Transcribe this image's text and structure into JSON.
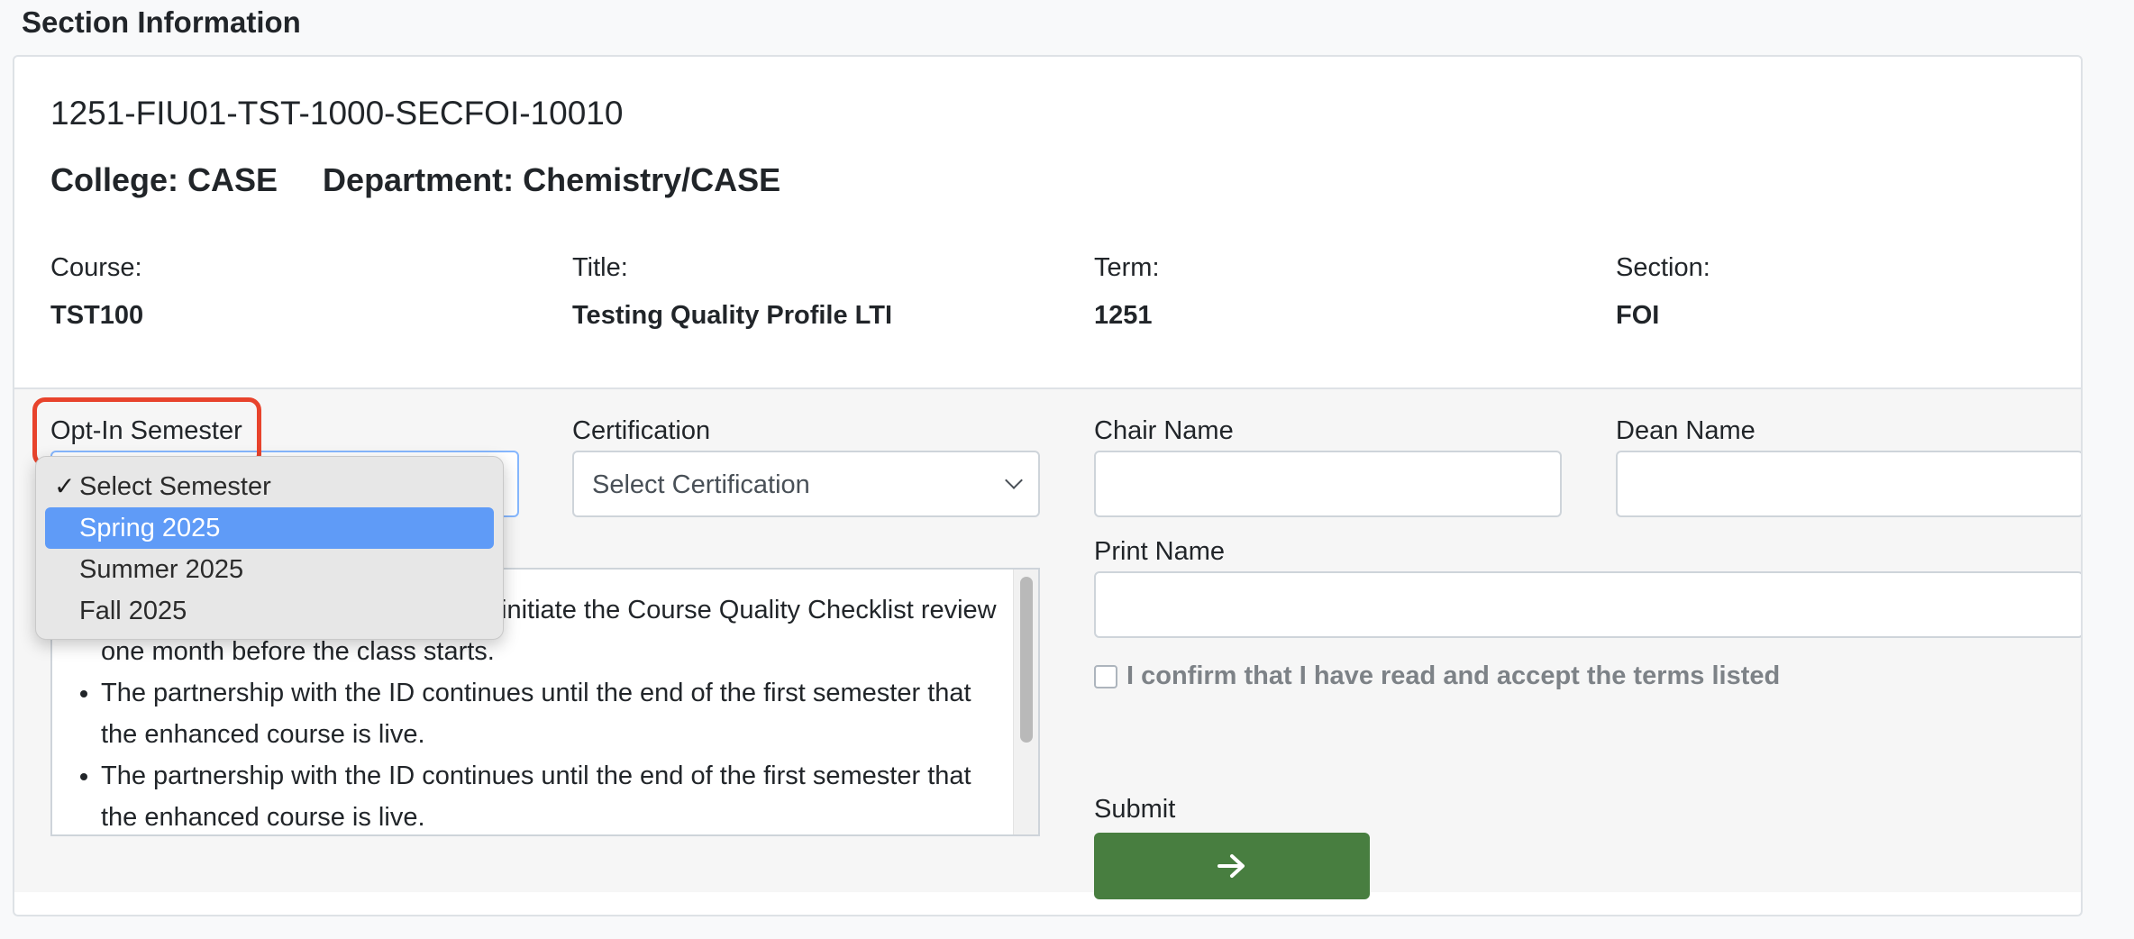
{
  "page": {
    "heading": "Section Information"
  },
  "section": {
    "code": "1251-FIU01-TST-1000-SECFOI-10010",
    "college": "College: CASE",
    "department": "Department: Chemistry/CASE",
    "course_label": "Course:",
    "course_value": "TST100",
    "title_label": "Title:",
    "title_value": "Testing Quality Profile LTI",
    "term_label": "Term:",
    "term_value": "1251",
    "section_label": "Section:",
    "section_value": "FOI"
  },
  "form": {
    "opt_in_label": "Opt-In Semester",
    "certification_label": "Certification",
    "certification_placeholder": "Select Certification",
    "chair_label": "Chair Name",
    "dean_label": "Dean Name",
    "print_label": "Print Name",
    "confirm_text": "I confirm that I have read and accept the terms listed",
    "submit_label": "Submit",
    "terms": [
      "initiate the Course Quality Checklist review one month before the class starts.",
      "The partnership with the ID continues until the end of the first semester that the enhanced course is live.",
      "The partnership with the ID continues until the end of the first semester that the enhanced course is live."
    ]
  },
  "dropdown": {
    "options": [
      {
        "label": "Select Semester",
        "checked": true
      },
      {
        "label": "Spring 2025",
        "highlighted": true
      },
      {
        "label": "Summer 2025"
      },
      {
        "label": "Fall 2025"
      }
    ],
    "check_glyph": "✓"
  },
  "colors": {
    "submit_bg": "#487e40",
    "highlight_ring": "#e8432c",
    "dropdown_selected": "#5f9bf7"
  },
  "icons": {
    "submit": "arrow-right-icon",
    "select": "chevron-down-icon"
  }
}
